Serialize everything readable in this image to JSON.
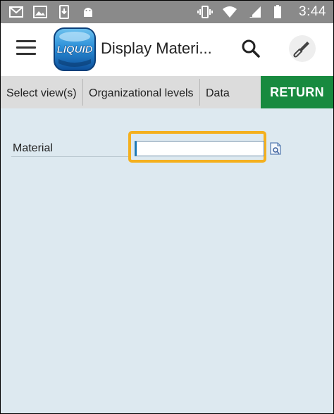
{
  "status_bar": {
    "time": "3:44",
    "left_icons": [
      "gmail-icon",
      "image-icon",
      "phone-download-icon",
      "android-icon"
    ],
    "right_icons": [
      "vibrate-icon",
      "wifi-icon",
      "signal-icon",
      "battery-icon"
    ]
  },
  "app_bar": {
    "logo_text": "LIQUID",
    "title": "Display Materi...",
    "icons": [
      "menu-icon",
      "search-icon",
      "tool-icon"
    ]
  },
  "tabs": [
    {
      "label": "Select view(s)"
    },
    {
      "label": "Organizational levels"
    },
    {
      "label": "Data"
    }
  ],
  "return_button": {
    "label": "RETURN",
    "color": "#188a3f"
  },
  "form": {
    "material_label": "Material",
    "material_value": "",
    "highlight_color": "#f4b01e"
  },
  "colors": {
    "content_bg": "#dde9f0",
    "status_bar_bg": "#8a8a8a",
    "tab_bar_bg": "#dcdcdc"
  }
}
